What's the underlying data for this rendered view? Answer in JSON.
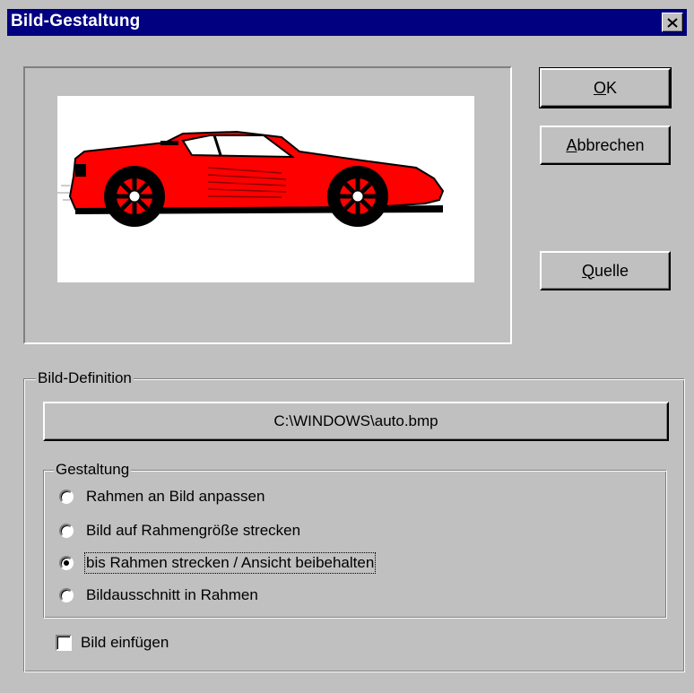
{
  "window": {
    "title": "Bild-Gestaltung",
    "close_glyph": "✕"
  },
  "buttons": {
    "ok": {
      "mnemonic": "O",
      "rest": "K"
    },
    "cancel": {
      "mnemonic": "A",
      "rest": "bbrechen"
    },
    "source": {
      "mnemonic": "Q",
      "rest": "uelle"
    }
  },
  "preview": {
    "image": "red-sports-car-image"
  },
  "definition": {
    "legend": "Bild-Definition",
    "path_button": "C:\\WINDOWS\\auto.bmp"
  },
  "layout_group": {
    "legend": "Gestaltung",
    "options": [
      {
        "label": "Rahmen an Bild anpassen",
        "selected": false
      },
      {
        "label": "Bild auf Rahmengröße strecken",
        "selected": false
      },
      {
        "label": "bis Rahmen strecken / Ansicht beibehalten",
        "selected": true
      },
      {
        "label": "Bildausschnitt in Rahmen",
        "selected": false
      }
    ]
  },
  "insert_checkbox": {
    "label": "Bild einfügen",
    "checked": false
  },
  "colors": {
    "titlebar": "#000080",
    "face": "#c0c0c0",
    "car": "#ff0000"
  }
}
